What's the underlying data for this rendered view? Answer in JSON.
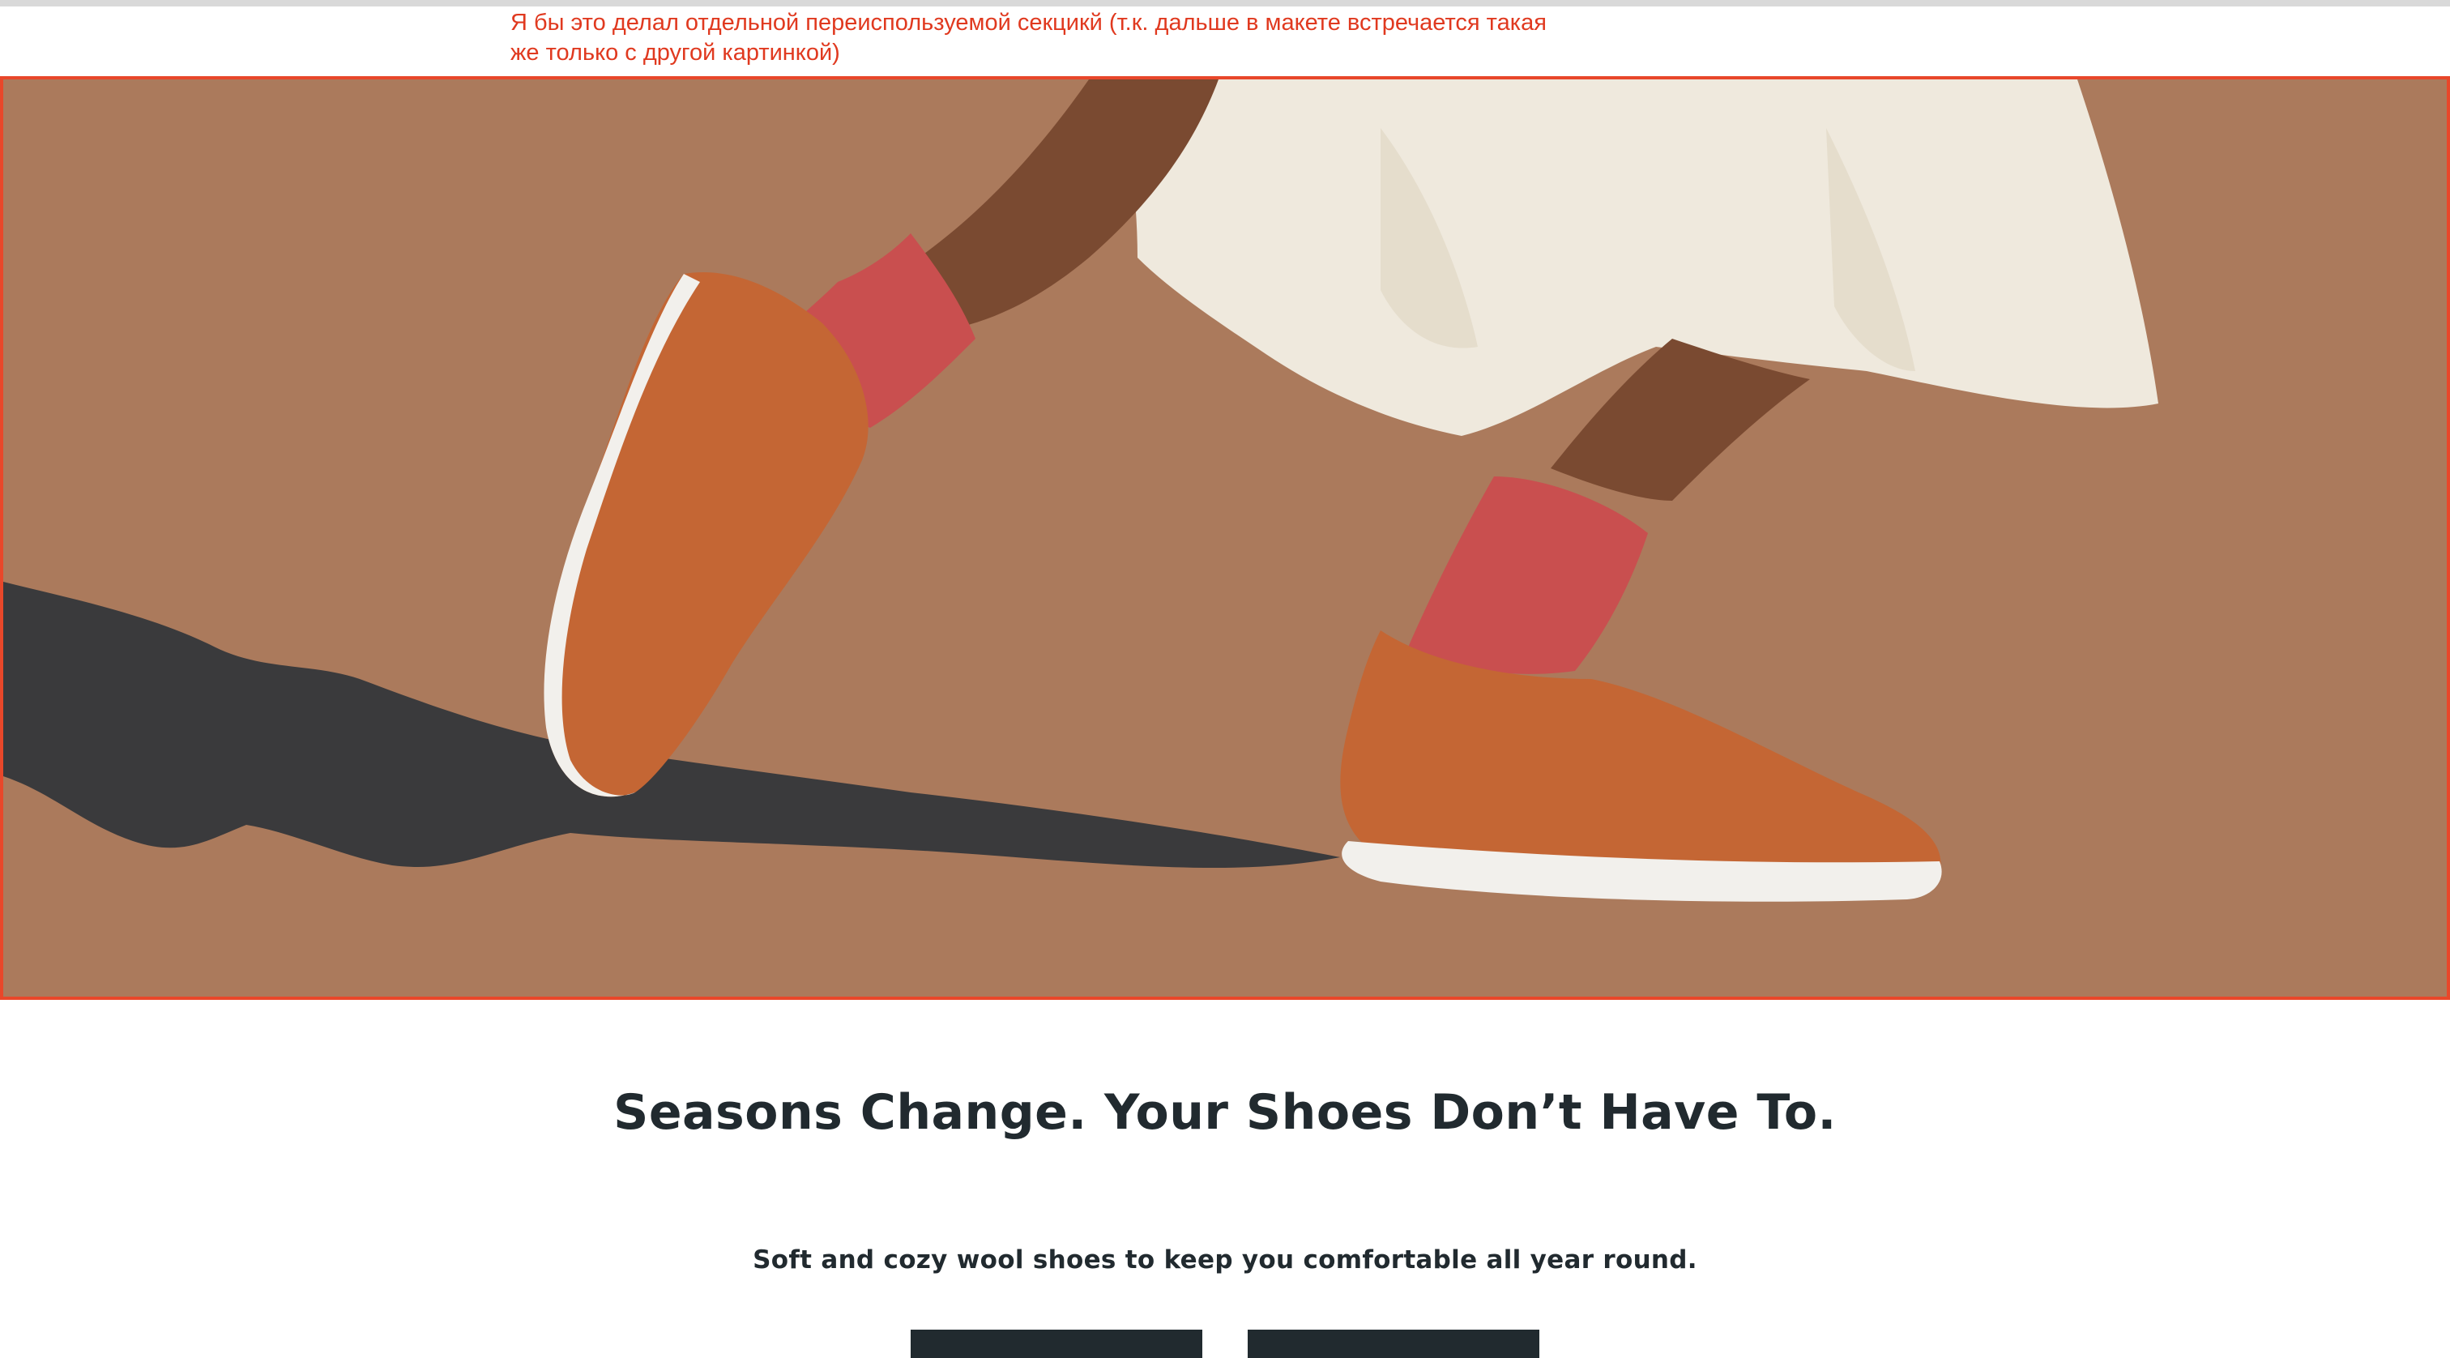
{
  "review_note": {
    "line1": "Я бы это делал отдельной переиспользуемой секцикй (т.к. дальше в макете встречается такая",
    "line2": "же только с другой картинкой)",
    "color": "#e0391f"
  },
  "hero": {
    "background_color": "#ab7a5c",
    "highlight_border_color": "#e8472a"
  },
  "content": {
    "headline": "Seasons Change. Your Shoes Don’t Have To.",
    "subtext": "Soft and cozy wool shoes to keep you comfortable all year round.",
    "buttons": [
      {
        "label": ""
      },
      {
        "label": ""
      }
    ],
    "text_color": "#212a2f"
  }
}
